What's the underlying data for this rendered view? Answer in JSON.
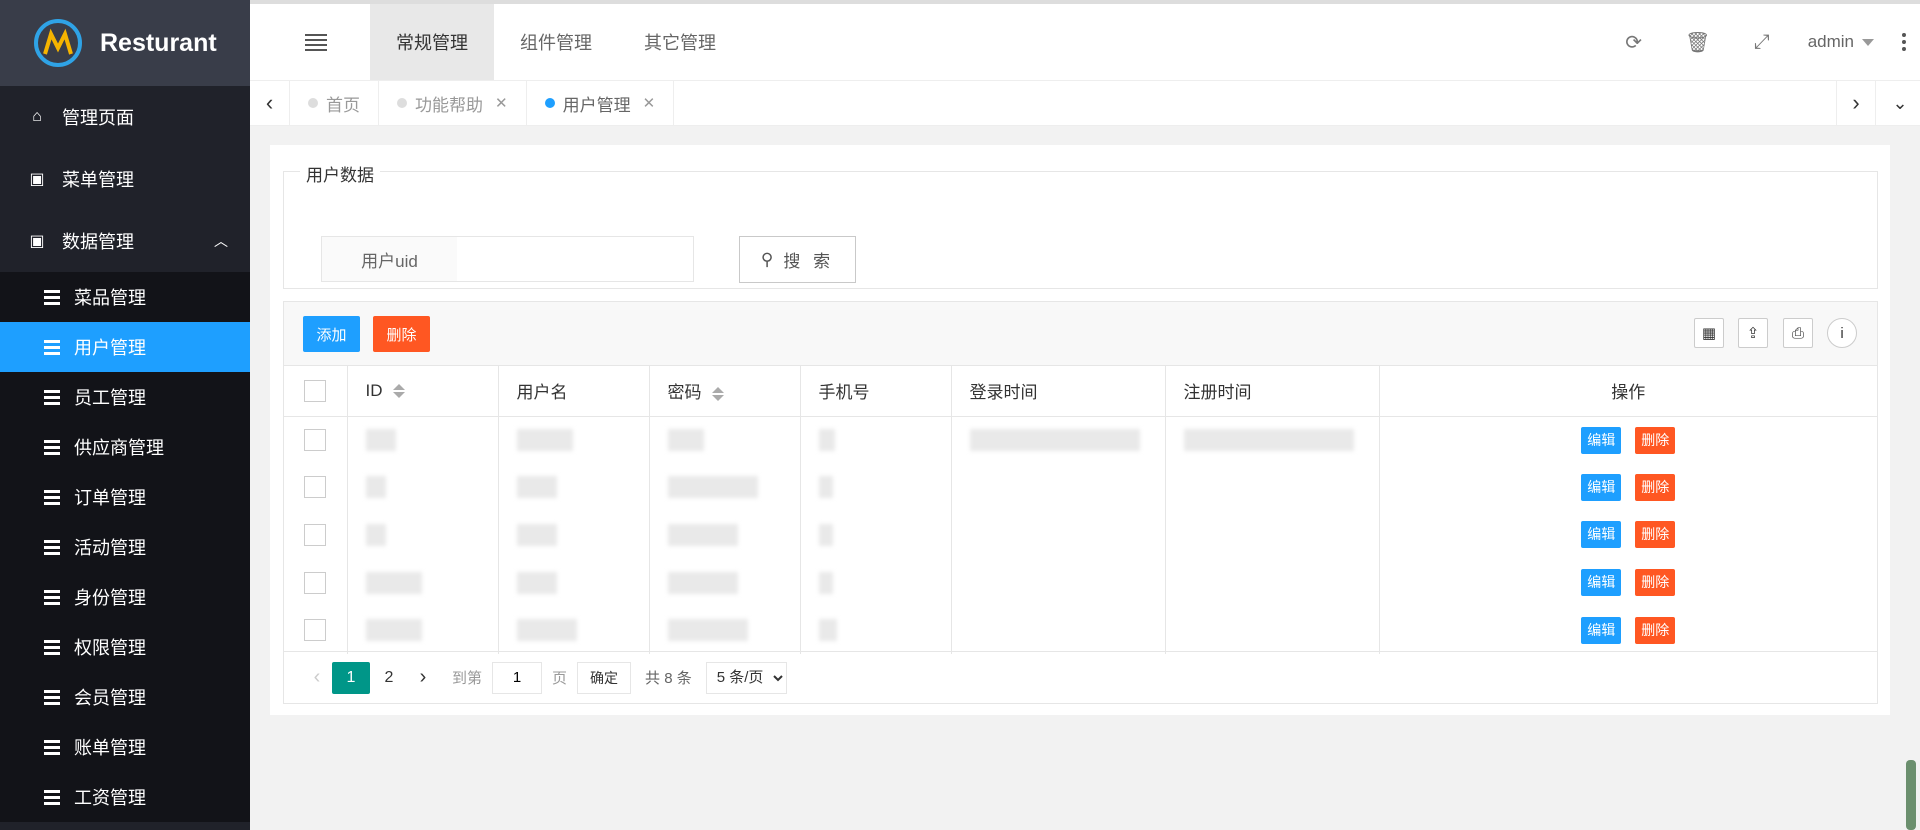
{
  "sidebar": {
    "brand": "Resturant",
    "top_items": [
      {
        "label": "管理页面",
        "icon": "home-icon"
      },
      {
        "label": "菜单管理",
        "icon": "window-icon"
      },
      {
        "label": "数据管理",
        "icon": "window-icon",
        "expanded": true
      }
    ],
    "sub_items": [
      {
        "label": "菜品管理"
      },
      {
        "label": "用户管理",
        "active": true
      },
      {
        "label": "员工管理"
      },
      {
        "label": "供应商管理"
      },
      {
        "label": "订单管理"
      },
      {
        "label": "活动管理"
      },
      {
        "label": "身份管理"
      },
      {
        "label": "权限管理"
      },
      {
        "label": "会员管理"
      },
      {
        "label": "账单管理"
      },
      {
        "label": "工资管理"
      }
    ]
  },
  "header": {
    "tabs": [
      "常规管理",
      "组件管理",
      "其它管理"
    ],
    "active_tab": "常规管理",
    "user": "admin"
  },
  "page_tabs": [
    {
      "label": "首页",
      "closable": false
    },
    {
      "label": "功能帮助",
      "closable": true
    },
    {
      "label": "用户管理",
      "closable": true,
      "active": true
    }
  ],
  "search": {
    "legend": "用户数据",
    "field_label": "用户uid",
    "field_value": "",
    "button_label": "搜 索"
  },
  "toolbar": {
    "add_label": "添加",
    "delete_label": "删除"
  },
  "table": {
    "columns": [
      "ID",
      "用户名",
      "密码",
      "手机号",
      "登录时间",
      "注册时间",
      "操作"
    ],
    "sortable": [
      "ID",
      "密码"
    ],
    "row_count": 5,
    "edit_label": "编辑",
    "delete_label": "删除"
  },
  "pagination": {
    "pages": [
      "1",
      "2"
    ],
    "current": "1",
    "goto_prefix": "到第",
    "goto_value": "1",
    "goto_suffix": "页",
    "confirm_label": "确定",
    "total_label": "共 8 条",
    "page_size": "5 条/页"
  },
  "colors": {
    "sidebar_bg": "#20222a",
    "active_blue": "#1e9fff",
    "danger": "#ff5722",
    "pager_green": "#009688"
  }
}
